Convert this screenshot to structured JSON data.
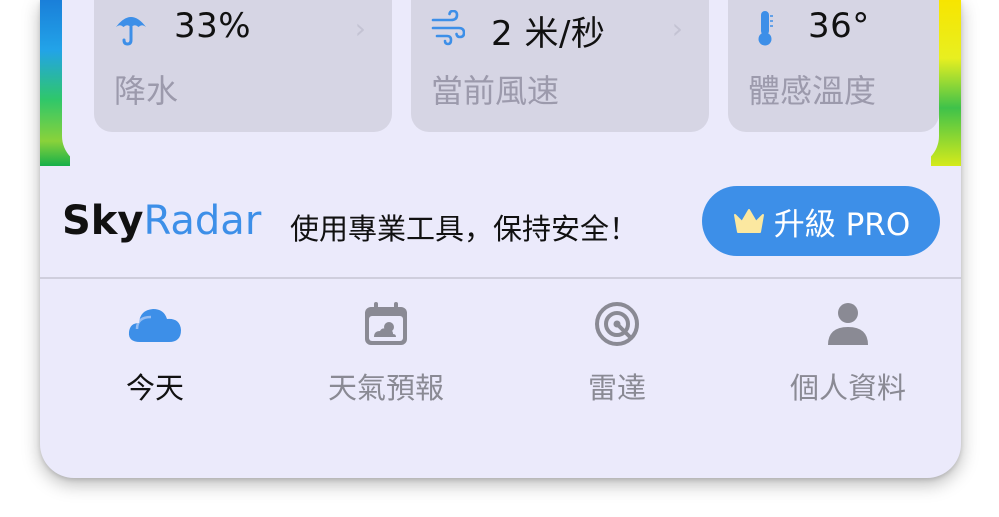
{
  "stats": [
    {
      "value": "33%",
      "label": "降水",
      "icon": "umbrella-icon"
    },
    {
      "value": "2 米/秒",
      "label": "當前風速",
      "icon": "wind-icon"
    },
    {
      "value": "36°",
      "label": "體感溫度",
      "icon": "thermometer-icon"
    }
  ],
  "chevron": "›",
  "promo": {
    "brand_primary": "Sky",
    "brand_secondary": "Radar",
    "message": "使用專業工具，保持安全！",
    "upgrade_label": "升級 PRO"
  },
  "tabs": [
    {
      "label": "今天",
      "icon": "cloud-icon",
      "active": true
    },
    {
      "label": "天氣預報",
      "icon": "calendar-icon",
      "active": false
    },
    {
      "label": "雷達",
      "icon": "radar-icon",
      "active": false
    },
    {
      "label": "個人資料",
      "icon": "person-icon",
      "active": false
    }
  ],
  "colors": {
    "accent": "#3d8fe8",
    "card_bg": "#d6d5e4",
    "panel_bg": "#ebeafb",
    "inactive_tab": "#8a8a94"
  }
}
